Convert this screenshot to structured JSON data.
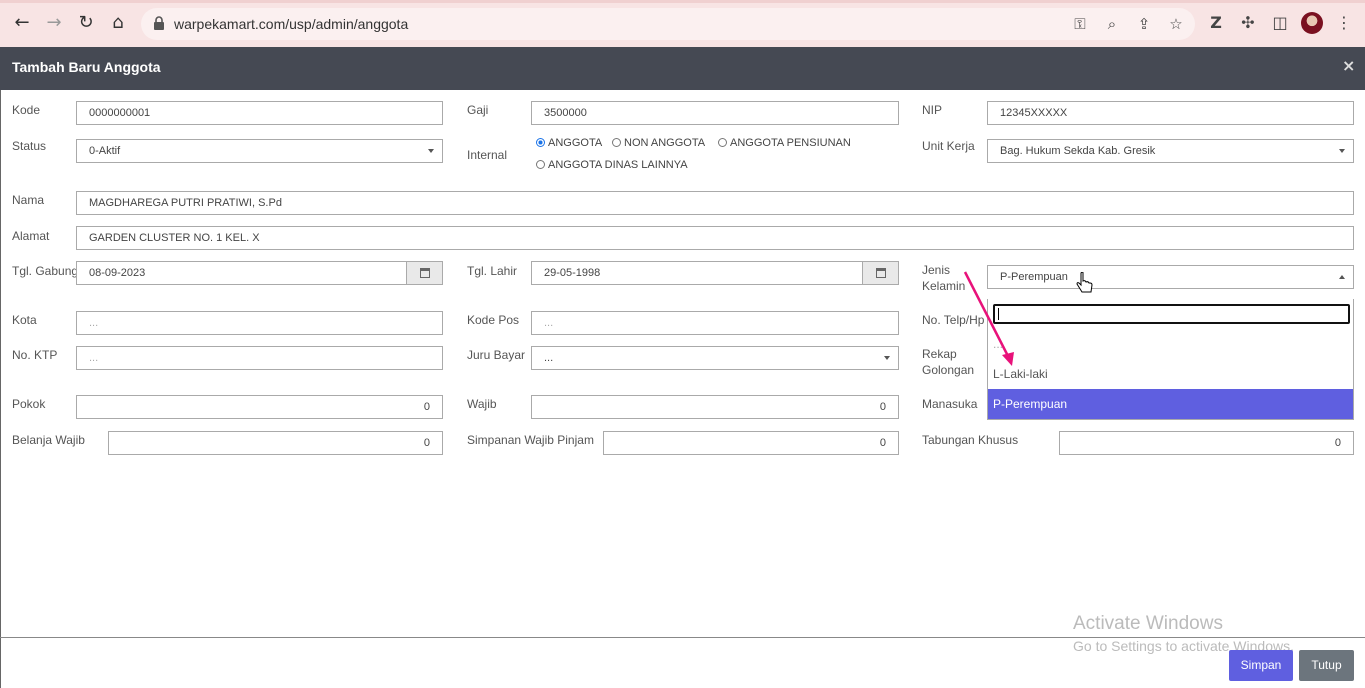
{
  "browser": {
    "url": "warpekamart.com/usp/admin/anggota",
    "colors": {
      "chrome_bg": "#f8e4e4"
    }
  },
  "modal": {
    "title": "Tambah Baru Anggota",
    "close_glyph": "×"
  },
  "form": {
    "kode": {
      "label": "Kode",
      "value": "0000000001"
    },
    "gaji": {
      "label": "Gaji",
      "value": "3500000"
    },
    "nip": {
      "label": "NIP",
      "value": "12345XXXXX"
    },
    "status": {
      "label": "Status",
      "value": "0-Aktif"
    },
    "internal": {
      "label": "Internal",
      "options": [
        "ANGGOTA",
        "NON ANGGOTA",
        "ANGGOTA PENSIUNAN",
        "ANGGOTA DINAS LAINNYA"
      ],
      "selected": "ANGGOTA"
    },
    "unit_kerja": {
      "label": "Unit Kerja",
      "value": "Bag. Hukum Sekda Kab. Gresik"
    },
    "nama": {
      "label": "Nama",
      "value": "MAGDHAREGA PUTRI PRATIWI, S.Pd"
    },
    "alamat": {
      "label": "Alamat",
      "value": "GARDEN CLUSTER NO. 1 KEL. X"
    },
    "tgl_gabung": {
      "label": "Tgl. Gabung",
      "value": "08-09-2023"
    },
    "tgl_lahir": {
      "label": "Tgl. Lahir",
      "value": "29-05-1998"
    },
    "jenis_kelamin": {
      "label_line1": "Jenis",
      "label_line2": "Kelamin",
      "value": "P-Perempuan",
      "options": [
        "...",
        "L-Laki-laki",
        "P-Perempuan"
      ],
      "highlighted": "P-Perempuan"
    },
    "kota": {
      "label": "Kota",
      "placeholder": "..."
    },
    "kode_pos": {
      "label": "Kode Pos",
      "placeholder": "..."
    },
    "no_telp": {
      "label": "No. Telp/Hp"
    },
    "no_ktp": {
      "label": "No. KTP",
      "placeholder": "..."
    },
    "juru_bayar": {
      "label": "Juru Bayar",
      "value": "..."
    },
    "rekap_golongan": {
      "label_line1": "Rekap",
      "label_line2": "Golongan"
    },
    "pokok": {
      "label": "Pokok",
      "value": "0"
    },
    "wajib": {
      "label": "Wajib",
      "value": "0"
    },
    "manasuka": {
      "label": "Manasuka"
    },
    "belanja_wajib": {
      "label": "Belanja Wajib",
      "value": "0"
    },
    "simpanan_wajib_pinjam": {
      "label": "Simpanan Wajib Pinjam",
      "value": "0"
    },
    "tabungan_khusus": {
      "label": "Tabungan Khusus",
      "value": "0"
    }
  },
  "buttons": {
    "simpan": "Simpan",
    "tutup": "Tutup"
  },
  "watermark": {
    "line1": "Activate Windows",
    "line2": "Go to Settings to activate Windows."
  },
  "colors": {
    "header_bg": "#454953",
    "primary": "#5f5fe0",
    "secondary": "#6c757d"
  }
}
